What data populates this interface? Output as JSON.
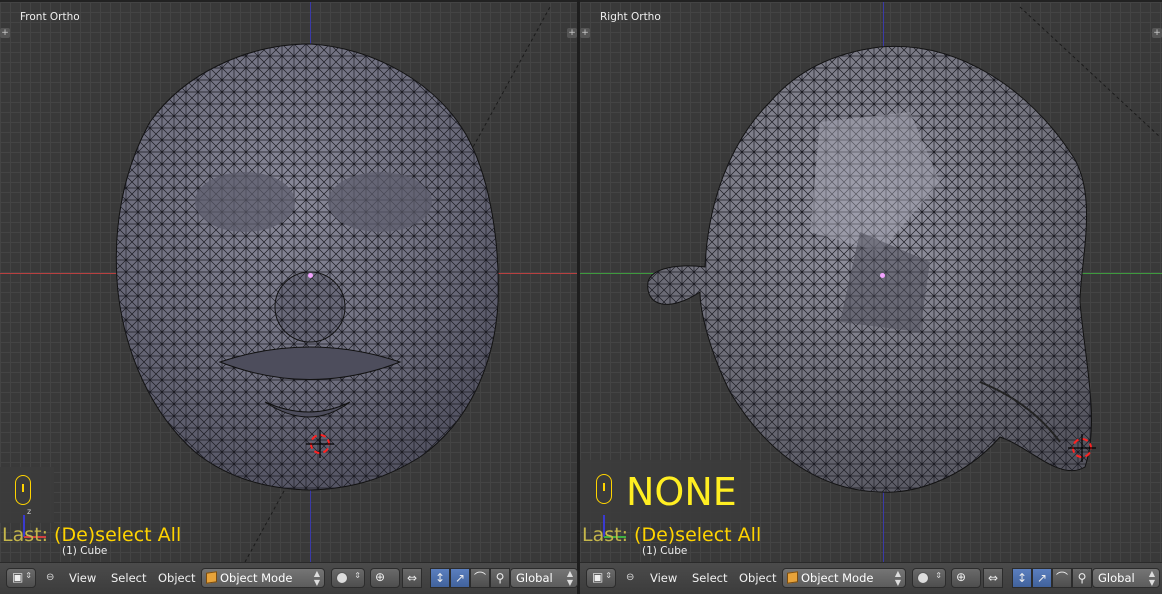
{
  "left_view": {
    "title": "Front Ortho",
    "key_text": "",
    "last_operator": {
      "prefix": "Last:",
      "name": "(De)select All"
    },
    "object_label": "(1) Cube"
  },
  "right_view": {
    "title": "Right Ortho",
    "key_text": "NONE",
    "last_operator": {
      "prefix": "Last:",
      "name": "(De)select All"
    },
    "object_label": "(1) Cube"
  },
  "header": {
    "menus": [
      "View",
      "Select",
      "Object"
    ],
    "mode": "Object Mode",
    "orientation": "Global"
  },
  "colors": {
    "x_axis": "#c64040",
    "y_axis": "#3e9a3e",
    "z_axis": "#3a3aa8",
    "key_highlight": "#ffee22",
    "last_operator": "#ffd400"
  },
  "icons": [
    "editor-type-icon",
    "hide-menu-icon",
    "cube-icon",
    "viewport-shading-icon",
    "pivot-icon",
    "manipulator-icon",
    "translate-icon",
    "rotate-icon",
    "scale-icon",
    "mouse-icon"
  ]
}
